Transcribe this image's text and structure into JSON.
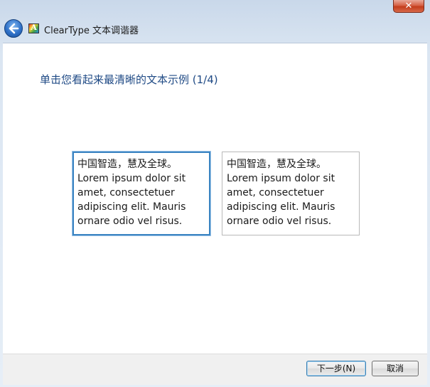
{
  "window": {
    "close_label": "✕",
    "title": "ClearType 文本调谐器",
    "icon_letter": "A"
  },
  "main": {
    "heading": "单击您看起来最清晰的文本示例 (1/4)",
    "samples": [
      {
        "line1": "中国智造，慧及全球。",
        "line2": "Lorem ipsum dolor sit amet, consectetuer adipiscing elit. Mauris ornare odio vel risus."
      },
      {
        "line1": "中国智造，慧及全球。",
        "line2": "Lorem ipsum dolor sit amet, consectetuer adipiscing elit. Mauris ornare odio vel risus."
      }
    ]
  },
  "footer": {
    "next_label": "下一步(N)",
    "cancel_label": "取消"
  },
  "colors": {
    "heading": "#1f4a85",
    "selected_border": "#3a84c2"
  }
}
